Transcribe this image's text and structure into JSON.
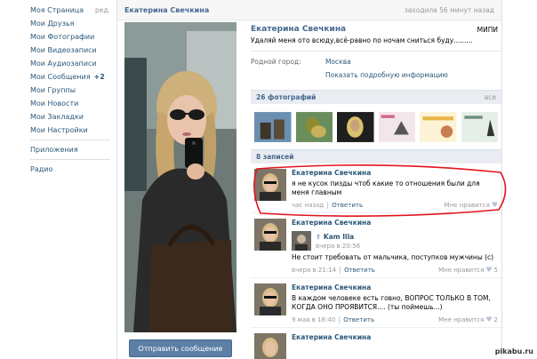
{
  "nav": {
    "items": [
      {
        "label": "Моя Страница",
        "edit": "ред."
      },
      {
        "label": "Мои Друзья"
      },
      {
        "label": "Мои Фотографии"
      },
      {
        "label": "Мои Видеозаписи"
      },
      {
        "label": "Мои Аудиозаписи"
      },
      {
        "label": "Мои Сообщения",
        "count": "+2"
      },
      {
        "label": "Мои Группы"
      },
      {
        "label": "Мои Новости"
      },
      {
        "label": "Мои Закладки"
      },
      {
        "label": "Мои Настройки"
      }
    ],
    "apps": "Приложения",
    "radio": "Радио"
  },
  "profile": {
    "header_name": "Екатерина Свечкина",
    "last_seen": "заходила 56 минут назад",
    "full_name": "Екатерина Свечкина",
    "university": "МИПИ",
    "status": "Удаляй меня ото всюду,всё-равно по ночам сниться буду.........",
    "hometown_label": "Родной город:",
    "hometown_value": "Москва",
    "more_info": "Показать подробную информацию",
    "send_message": "Отправить сообщение"
  },
  "photos": {
    "title": "26 фотографий",
    "all": "все"
  },
  "wall": {
    "title": "8 записей",
    "posts": [
      {
        "author": "Екатерина Свечкина",
        "text": "я не кусок пизды чтоб какие то отношения были для меня главным",
        "time": "час назад",
        "reply": "Ответить",
        "like": "Мне нравится"
      },
      {
        "author": "Екатерина Свечкина",
        "repost_author": "Kam Illa",
        "repost_date": "вчера в 20:56",
        "text": "Не стоит требовать от мальчика, поступков мужчины (с)",
        "time": "вчера в 21:14",
        "reply": "Ответить",
        "like": "Мне нравится",
        "likes": "5"
      },
      {
        "author": "Екатерина Свечкина",
        "text": "В каждом человеке есть говно, ВОПРОС ТОЛЬКО В ТОМ, КОГДА ОНО ПРОЯВИТСЯ.... (ты поймешь...)",
        "time": "9 мая в 18:40",
        "reply": "Ответить",
        "like": "Мне нравится",
        "likes": "2"
      },
      {
        "author": "Екатерина Свечкина"
      }
    ]
  },
  "watermark": "pikabu.ru",
  "colors": {
    "link": "#2b587a",
    "header_bg": "#e9edf1",
    "button": "#5c7fa6",
    "highlight": "#e3141e"
  }
}
